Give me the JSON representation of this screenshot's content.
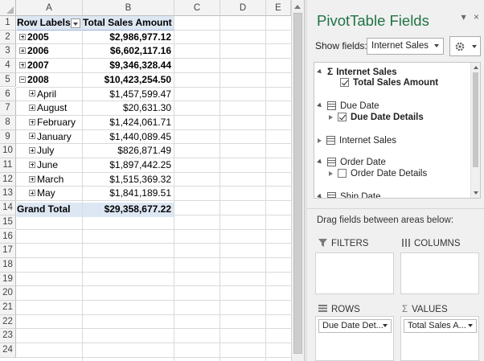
{
  "sheet": {
    "columns": [
      "A",
      "B",
      "C",
      "D",
      "E"
    ],
    "rows": [
      "1",
      "2",
      "3",
      "4",
      "5",
      "6",
      "7",
      "8",
      "9",
      "10",
      "11",
      "12",
      "13",
      "14",
      "15",
      "16",
      "17",
      "18",
      "19",
      "20",
      "21",
      "22",
      "23",
      "24"
    ],
    "header": {
      "row_labels": "Row Labels",
      "total_sales": "Total Sales Amount"
    },
    "pivot_rows": [
      {
        "label": "2005",
        "value": "$2,986,977.12",
        "level": 0,
        "expanded": false
      },
      {
        "label": "2006",
        "value": "$6,602,117.16",
        "level": 0,
        "expanded": false
      },
      {
        "label": "2007",
        "value": "$9,346,328.44",
        "level": 0,
        "expanded": false
      },
      {
        "label": "2008",
        "value": "$10,423,254.50",
        "level": 0,
        "expanded": true
      },
      {
        "label": "April",
        "value": "$1,457,599.47",
        "level": 1,
        "expanded": false
      },
      {
        "label": "August",
        "value": "$20,631.30",
        "level": 1,
        "expanded": false
      },
      {
        "label": "February",
        "value": "$1,424,061.71",
        "level": 1,
        "expanded": false
      },
      {
        "label": "January",
        "value": "$1,440,089.45",
        "level": 1,
        "expanded": false
      },
      {
        "label": "July",
        "value": "$826,871.49",
        "level": 1,
        "expanded": false
      },
      {
        "label": "June",
        "value": "$1,897,442.25",
        "level": 1,
        "expanded": false
      },
      {
        "label": "March",
        "value": "$1,515,369.32",
        "level": 1,
        "expanded": false
      },
      {
        "label": "May",
        "value": "$1,841,189.51",
        "level": 1,
        "expanded": false
      }
    ],
    "grand_total": {
      "label": "Grand Total",
      "value": "$29,358,677.22"
    }
  },
  "pane": {
    "title": "PivotTable Fields",
    "dropdown_glyph": "▾",
    "close_glyph": "×",
    "show_fields_label": "Show fields:",
    "show_fields_value": "Internet Sales",
    "field_list": [
      {
        "kind": "table-sigma",
        "label": "Internet Sales",
        "bold": true
      },
      {
        "kind": "field",
        "label": "Total Sales Amount",
        "checked": true,
        "bold": true
      },
      {
        "kind": "table",
        "label": "Due Date",
        "bold": false
      },
      {
        "kind": "field-folder",
        "label": "Due Date Details",
        "checked": true,
        "bold": true
      },
      {
        "kind": "table-collapsed",
        "label": "Internet Sales",
        "bold": false
      },
      {
        "kind": "table",
        "label": "Order Date",
        "bold": false
      },
      {
        "kind": "field-folder",
        "label": "Order Date Details",
        "checked": false,
        "bold": false
      },
      {
        "kind": "table",
        "label": "Ship Date",
        "bold": false
      }
    ],
    "drag_label": "Drag fields between areas below:",
    "areas": {
      "filters": {
        "label": "FILTERS",
        "items": []
      },
      "columns": {
        "label": "COLUMNS",
        "items": []
      },
      "rows": {
        "label": "ROWS",
        "items": [
          "Due Date Det..."
        ]
      },
      "values": {
        "label": "VALUES",
        "items": [
          "Total Sales A..."
        ]
      }
    }
  },
  "colors": {
    "pane_title": "#217346",
    "pivot_header_fill": "#dde7f3"
  }
}
